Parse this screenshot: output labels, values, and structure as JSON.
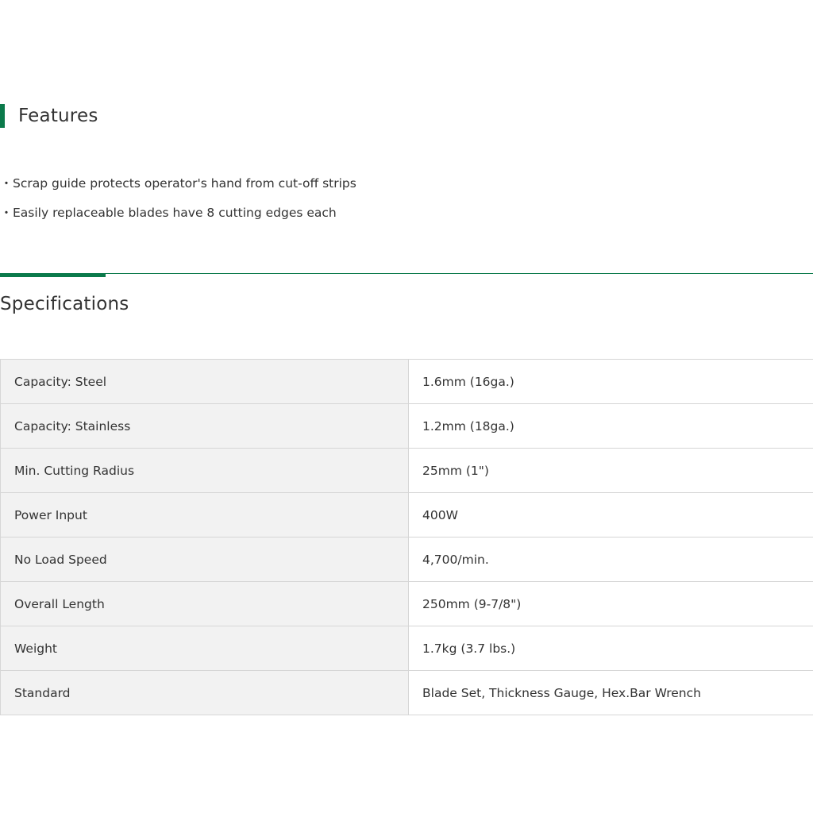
{
  "features": {
    "title": "Features",
    "bullet": "・",
    "items": [
      "Scrap guide protects operator's hand from cut-off strips",
      "Easily replaceable blades have 8 cutting edges each"
    ]
  },
  "specifications": {
    "title": "Specifications",
    "rows": [
      {
        "label": "Capacity: Steel",
        "value": "1.6mm (16ga.)"
      },
      {
        "label": "Capacity: Stainless",
        "value": "1.2mm (18ga.)"
      },
      {
        "label": "Min. Cutting Radius",
        "value": "25mm (1\")"
      },
      {
        "label": "Power Input",
        "value": "400W"
      },
      {
        "label": "No Load Speed",
        "value": "4,700/min."
      },
      {
        "label": "Overall Length",
        "value": "250mm (9-7/8\")"
      },
      {
        "label": "Weight",
        "value": "1.7kg (3.7 lbs.)"
      },
      {
        "label": "Standard",
        "value": "Blade Set, Thickness Gauge, Hex.Bar Wrench"
      }
    ]
  },
  "colors": {
    "accent": "#0b7a4b",
    "label_cell_bg": "#f2f2f2",
    "border": "#d6d6d6",
    "text": "#333333"
  }
}
